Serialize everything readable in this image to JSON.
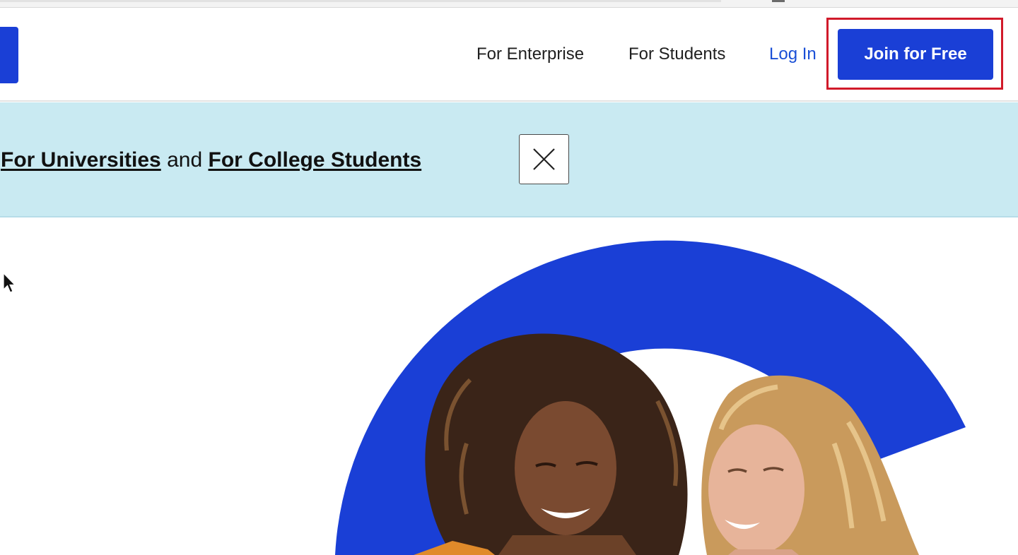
{
  "colors": {
    "brand_blue": "#1a3fd6",
    "link_blue": "#1a4fd6",
    "banner_bg": "#c9eaf2",
    "highlight_red": "#d11a2a"
  },
  "header": {
    "nav": {
      "enterprise": "For Enterprise",
      "students": "For Students",
      "login": "Log In"
    },
    "join_button": "Join for Free"
  },
  "banner": {
    "link_universities": "For Universities",
    "connector": "and",
    "link_college_students": "For College Students",
    "close_icon": "close-icon"
  },
  "hero": {
    "image": "two-smiling-women-over-blue-circle"
  }
}
